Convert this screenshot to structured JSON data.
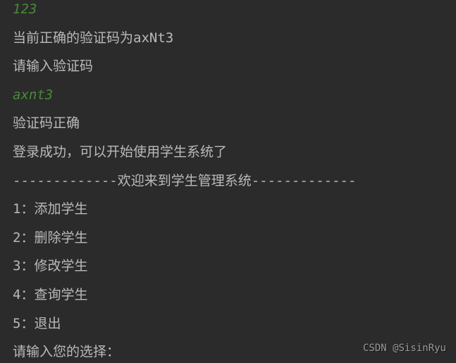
{
  "console": {
    "password_input": "123",
    "captcha_correct": "当前正确的验证码为axNt3",
    "captcha_prompt": "请输入验证码",
    "captcha_input": "axnt3",
    "captcha_ok": "验证码正确",
    "login_success": "登录成功，可以开始使用学生系统了",
    "welcome_banner": "-------------欢迎来到学生管理系统-------------",
    "menu": {
      "item1": "1：添加学生",
      "item2": "2：删除学生",
      "item3": "3：修改学生",
      "item4": "4：查询学生",
      "item5": "5：退出"
    },
    "choice_prompt": "请输入您的选择："
  },
  "watermark": "CSDN @SisinRyu"
}
